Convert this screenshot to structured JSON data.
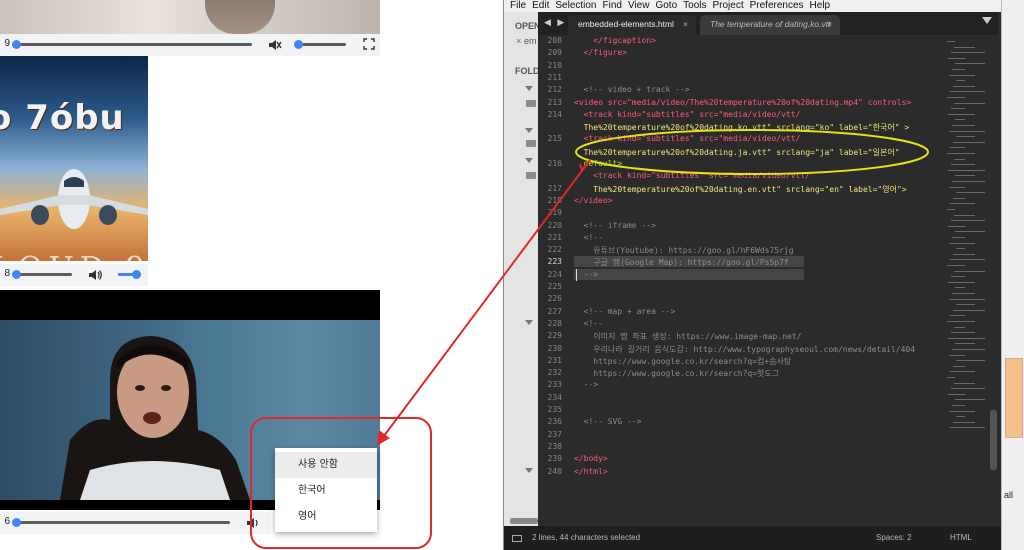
{
  "left_pane": {
    "video1": {
      "time": "9"
    },
    "poster": {
      "logo_text": "o 7óbu",
      "bottom_text": "LOUD 9"
    },
    "audio2": {
      "time": "8"
    },
    "video3": {
      "time": "6",
      "subtitle_menu": {
        "items": [
          "사용 안함",
          "한국어",
          "영어"
        ],
        "hovered_item": "사용 안함"
      }
    }
  },
  "editor": {
    "menu": [
      "File",
      "Edit",
      "Selection",
      "Find",
      "View",
      "Goto",
      "Tools",
      "Project",
      "Preferences",
      "Help"
    ],
    "sidebar": {
      "open_label": "OPEN",
      "open_file": "em",
      "folders_label": "FOLD"
    },
    "tabs": [
      {
        "label": "embedded-elements.html",
        "active": true,
        "close": "×"
      },
      {
        "label": "The temperature of dating.ko.vtt",
        "active": false,
        "close": "×"
      }
    ],
    "tab_nav": "◀ ▶",
    "line_numbers": [
      "208",
      "209",
      "210",
      "211",
      "212",
      "213",
      "214",
      "",
      "215",
      "",
      "216",
      "",
      "217",
      "218",
      "219",
      "220",
      "221",
      "222",
      "223",
      "224",
      "225",
      "226",
      "227",
      "228",
      "229",
      "230",
      "231",
      "232",
      "233",
      "234",
      "235",
      "236",
      "237",
      "238",
      "239",
      "240"
    ],
    "current_line": "223",
    "code_lines": [
      "    </figcaption>",
      "  </figure>",
      "",
      "",
      "  <!-- video + track -->",
      "<video src=\"media/video/The%20temperature%20of%20dating.mp4\" controls>",
      "  <track kind=\"subtitles\" src=\"media/video/vtt/",
      "  The%20temperature%20of%20dating.ko.vtt\" srclang=\"ko\" label=\"한국어\" >",
      "  <track kind=\"subtitles\" src=\"media/video/vtt/",
      "  The%20temperature%20of%20dating.ja.vtt\" srclang=\"ja\" label=\"일본어\"",
      "  default>",
      "    <track kind=\"subtitles\" src=\"media/video/vtt/",
      "    The%20temperature%20of%20dating.en.vtt\" srclang=\"en\" label=\"영어\">",
      "</video>",
      "",
      "  <!-- iframe -->",
      "  <!--",
      "    유튜브(Youtube): https://goo.gl/hF6Wds75rjg",
      "    구글 맵(Google Map): https://goo.gl/Ps5p7f",
      "  -->",
      "",
      "",
      "  <!-- map + area -->",
      "  <!--",
      "    이미지 맵 좌표 생성: https://www.image-map.net/",
      "    우리나라 길거리 음식도감: http://www.typographyseoul.com/news/detail/404",
      "    https://www.google.co.kr/search?q=컵+솜사탕",
      "    https://www.google.co.kr/search?q=핫도그",
      "  -->",
      "",
      "",
      "  <!-- SVG -->",
      "",
      "",
      "</body>",
      "</html>",
      ""
    ],
    "status": {
      "selection": "2 lines, 44 characters selected",
      "spaces": "Spaces: 2",
      "syntax": "HTML"
    },
    "right_edge_text": "all"
  },
  "colors": {
    "annotation_red": "#e02828",
    "annotation_yellow": "#e6e01e",
    "progress_blue": "#4285f4"
  }
}
